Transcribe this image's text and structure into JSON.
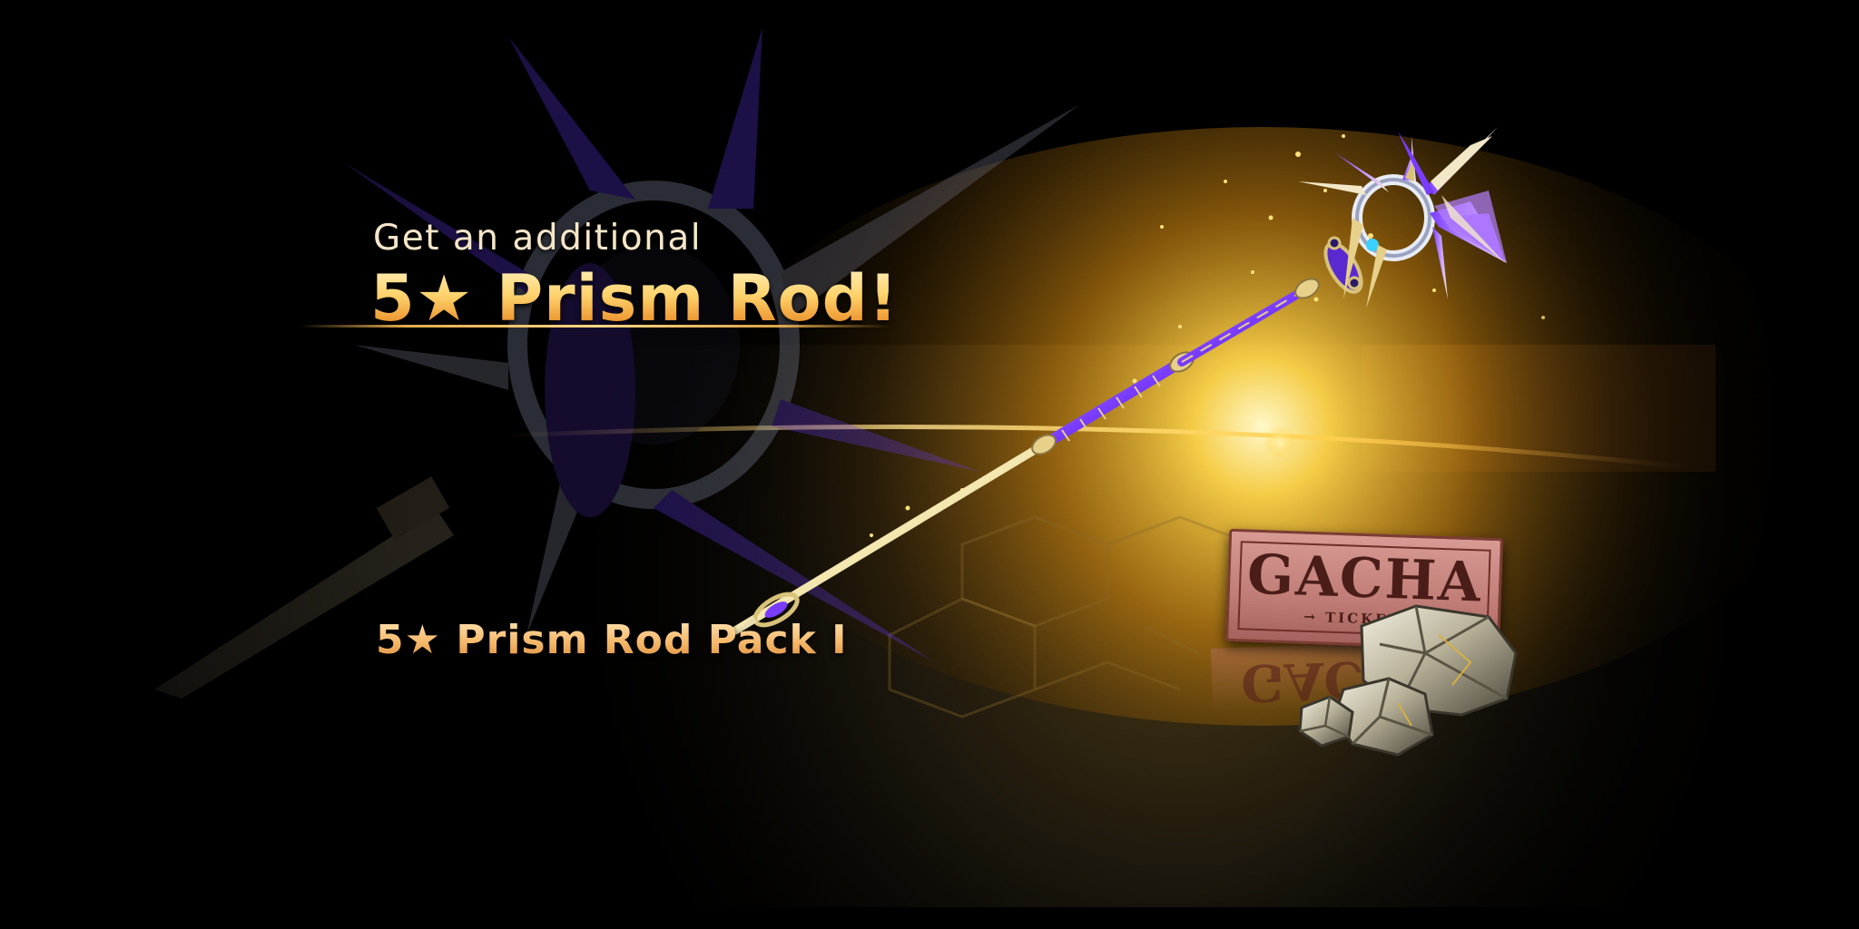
{
  "banner": {
    "subtitle": "Get an additional",
    "headline": "5★ Prism Rod!",
    "pack_name": "5★ Prism Rod Pack I"
  },
  "ticket": {
    "title": "GACHA",
    "subtitle": "→ TICKET ←"
  },
  "colors": {
    "background": "#000000",
    "glow": "#ffd24a",
    "rod_purple": "#7a3cff",
    "text_gold": "#f5b86a",
    "ticket_pink": "#c07c76"
  },
  "icons": {
    "weapon": "prism-rod-icon",
    "ticket": "gacha-ticket-icon",
    "ore": "ore-stones-icon"
  }
}
